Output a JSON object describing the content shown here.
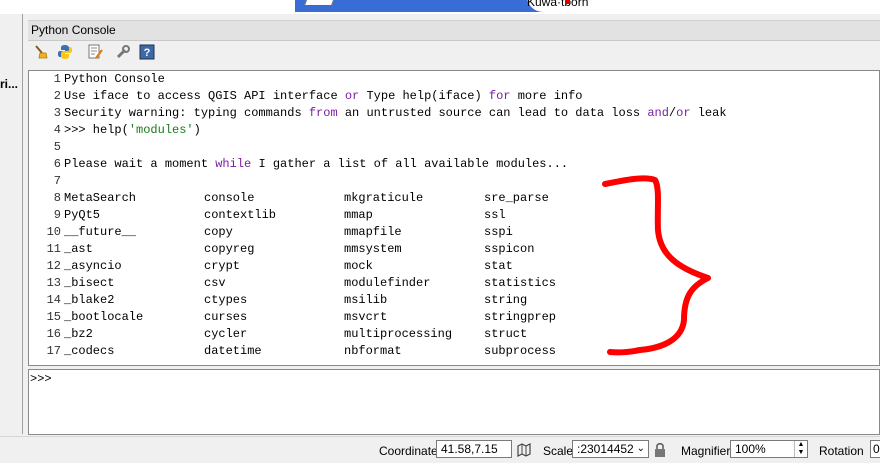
{
  "map": {
    "label": "Kuwa·tborn"
  },
  "left_panel": {
    "truncated_text": "ri..."
  },
  "dock": {
    "title": "Python Console"
  },
  "toolbar": {
    "buttons": [
      {
        "name": "clear-console-button",
        "icon": "broom-icon"
      },
      {
        "name": "run-command-button",
        "icon": "python-icon"
      },
      {
        "name": "show-editor-button",
        "icon": "editor-icon"
      },
      {
        "name": "settings-button",
        "icon": "wrench-icon"
      },
      {
        "name": "help-button",
        "icon": "help-icon"
      }
    ]
  },
  "console": {
    "lines": [
      "Python Console",
      "Use iface to access QGIS API interface or Type help(iface) for more info",
      "Security warning: typing commands from an untrusted source can lead to data loss and/or leak",
      ">>> help('modules')",
      "",
      "Please wait a moment while I gather a list of all available modules...",
      ""
    ],
    "module_rows": [
      [
        "MetaSearch",
        "console",
        "mkgraticule",
        "sre_parse"
      ],
      [
        "PyQt5",
        "contextlib",
        "mmap",
        "ssl"
      ],
      [
        "__future__",
        "copy",
        "mmapfile",
        "sspi"
      ],
      [
        "_ast",
        "copyreg",
        "mmsystem",
        "sspicon"
      ],
      [
        "_asyncio",
        "crypt",
        "mock",
        "stat"
      ],
      [
        "_bisect",
        "csv",
        "modulefinder",
        "statistics"
      ],
      [
        "_blake2",
        "ctypes",
        "msilib",
        "string"
      ],
      [
        "_bootlocale",
        "curses",
        "msvcrt",
        "stringprep"
      ],
      [
        "_bz2",
        "cycler",
        "multiprocessing",
        "struct"
      ],
      [
        "_codecs",
        "datetime",
        "nbformat",
        "subprocess"
      ]
    ],
    "line_numbers": [
      "1",
      "2",
      "3",
      "4",
      "5",
      "6",
      "7",
      "8",
      "9",
      "10",
      "11",
      "12",
      "13",
      "14",
      "15",
      "16",
      "17"
    ]
  },
  "input": {
    "prompt": ">>>"
  },
  "status_bar": {
    "coordinate_label": "Coordinate",
    "coordinate_value": "41.58,7.15",
    "scale_label": "Scale",
    "scale_value": ":23014452",
    "magnifier_label": "Magnifier",
    "magnifier_value": "100%",
    "rotation_label": "Rotation",
    "rotation_value": "0"
  },
  "colors": {
    "annotation": "#ff0000",
    "keyword": "#7b1fa2",
    "string": "#1b7a1b"
  }
}
